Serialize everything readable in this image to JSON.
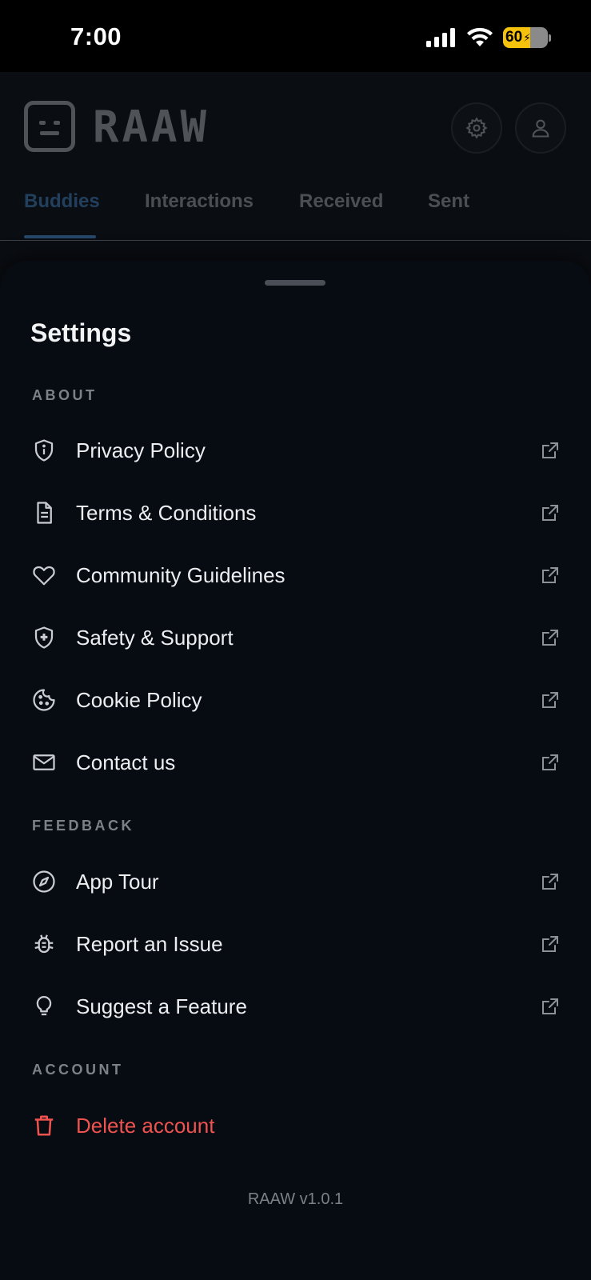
{
  "status_bar": {
    "time": "7:00",
    "battery_level": "60",
    "icons": [
      "signal-icon",
      "wifi-icon",
      "battery-charging-icon"
    ]
  },
  "header": {
    "app_name": "RAAW",
    "buttons": [
      "settings-icon",
      "profile-icon"
    ]
  },
  "tabs": [
    {
      "label": "Buddies",
      "active": true
    },
    {
      "label": "Interactions",
      "active": false
    },
    {
      "label": "Received",
      "active": false
    },
    {
      "label": "Sent",
      "active": false
    }
  ],
  "sheet": {
    "title": "Settings",
    "sections": {
      "about": {
        "label": "ABOUT",
        "items": [
          {
            "label": "Privacy Policy",
            "icon": "shield-info-icon"
          },
          {
            "label": "Terms & Conditions",
            "icon": "document-icon"
          },
          {
            "label": "Community Guidelines",
            "icon": "heart-icon"
          },
          {
            "label": "Safety & Support",
            "icon": "shield-plus-icon"
          },
          {
            "label": "Cookie Policy",
            "icon": "cookie-icon"
          },
          {
            "label": "Contact us",
            "icon": "mail-icon"
          }
        ]
      },
      "feedback": {
        "label": "FEEDBACK",
        "items": [
          {
            "label": "App Tour",
            "icon": "compass-icon"
          },
          {
            "label": "Report an Issue",
            "icon": "bug-icon"
          },
          {
            "label": "Suggest a Feature",
            "icon": "lightbulb-icon"
          }
        ]
      },
      "account": {
        "label": "ACCOUNT",
        "items": [
          {
            "label": "Delete account",
            "icon": "trash-icon"
          }
        ]
      }
    },
    "version": "RAAW v1.0.1"
  },
  "colors": {
    "accent": "#4f9fe8",
    "danger": "#ef5350",
    "sheet_bg": "#070b12",
    "battery": "#f4c20d"
  }
}
